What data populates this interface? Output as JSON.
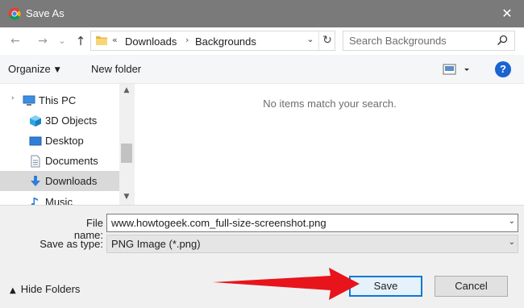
{
  "window": {
    "title": "Save As",
    "close_glyph": "✕"
  },
  "navigation": {
    "back_glyph": "←",
    "forward_glyph": "→",
    "recent_glyph": "⌄",
    "up_glyph": "↑"
  },
  "address_bar": {
    "prefix_glyph": "«",
    "crumbs": [
      "Downloads",
      "Backgrounds"
    ],
    "separator_glyph": "›",
    "dropdown_glyph": "⌄",
    "refresh_glyph": "↻"
  },
  "search": {
    "placeholder": "Search Backgrounds"
  },
  "toolbar": {
    "organize_label": "Organize",
    "organize_caret": "▼",
    "new_folder_label": "New folder",
    "help_label": "?"
  },
  "nav_pane": {
    "items": [
      {
        "label": "This PC",
        "icon": "computer-icon"
      },
      {
        "label": "3D Objects",
        "icon": "cube-icon"
      },
      {
        "label": "Desktop",
        "icon": "desktop-icon"
      },
      {
        "label": "Documents",
        "icon": "document-icon"
      },
      {
        "label": "Downloads",
        "icon": "download-arrow-icon",
        "selected": true
      },
      {
        "label": "Music",
        "icon": "music-note-icon"
      }
    ],
    "expand_glyph": "›",
    "scroll_up_glyph": "▲",
    "scroll_down_glyph": "▼"
  },
  "content": {
    "empty_message": "No items match your search."
  },
  "form": {
    "file_name_label": "File name:",
    "file_name_value": "www.howtogeek.com_full-size-screenshot.png",
    "save_type_label": "Save as type:",
    "save_type_value": "PNG Image (*.png)",
    "dropdown_glyph": "⌄"
  },
  "footer": {
    "hide_folders_label": "Hide Folders",
    "hide_folders_caret": "▲",
    "save_label": "Save",
    "cancel_label": "Cancel"
  },
  "colors": {
    "titlebar": "#7a7a7a",
    "accent": "#0a78d7",
    "annotation_arrow": "#e8141b",
    "help": "#1a63d2"
  }
}
